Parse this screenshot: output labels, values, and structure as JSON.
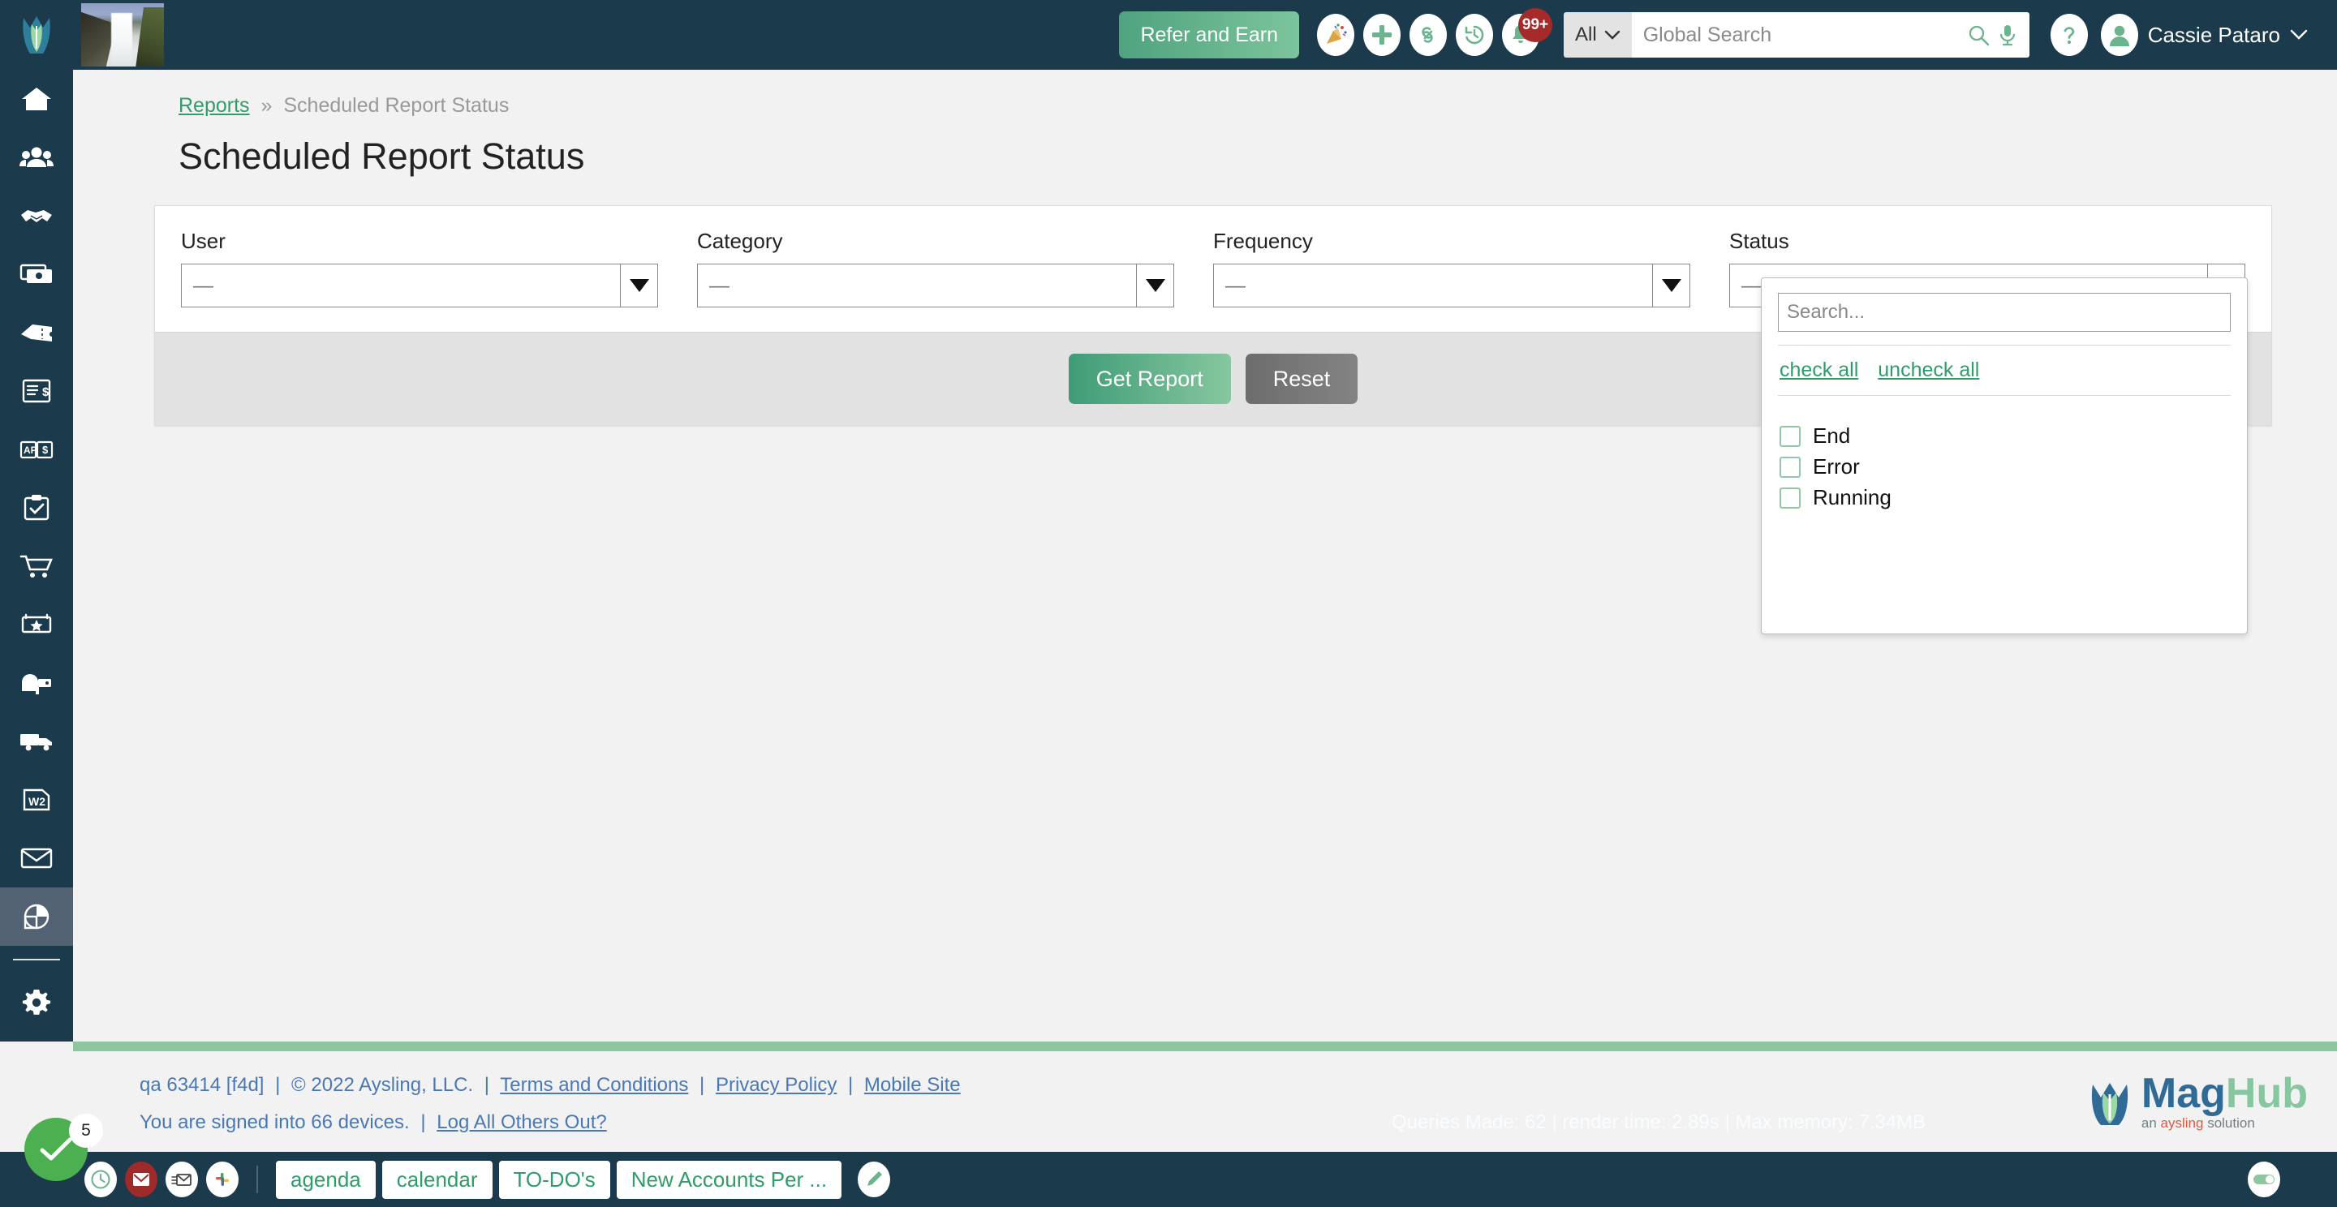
{
  "header": {
    "logo_icon": "dragon-logo",
    "thumbnail_icon": "waterfall-thumbnail",
    "refer_label": "Refer and Earn",
    "icons": [
      {
        "name": "party-popper-icon",
        "label": "party-popper"
      },
      {
        "name": "plus-icon",
        "label": "plus"
      },
      {
        "name": "link-icon",
        "label": "link"
      },
      {
        "name": "history-clock-icon",
        "label": "history"
      },
      {
        "name": "bell-icon",
        "label": "notifications"
      }
    ],
    "notification_badge": "99+",
    "search_scope": "All",
    "search_placeholder": "Global Search",
    "search_value": "",
    "help_label": "?",
    "user_name": "Cassie Pataro"
  },
  "sidebar": {
    "items": [
      {
        "name": "sidebar-item-home",
        "icon": "home-icon",
        "active": false
      },
      {
        "name": "sidebar-item-contacts",
        "icon": "people-group-icon",
        "active": false
      },
      {
        "name": "sidebar-item-deals",
        "icon": "handshake-icon",
        "active": false
      },
      {
        "name": "sidebar-item-billing",
        "icon": "money-bill-icon",
        "active": false
      },
      {
        "name": "sidebar-item-tickets",
        "icon": "ticket-icon",
        "active": false
      },
      {
        "name": "sidebar-item-invoices",
        "icon": "invoice-dollar-icon",
        "active": false
      },
      {
        "name": "sidebar-item-accounts-payable",
        "icon": "ap-book-dollar-icon",
        "active": false
      },
      {
        "name": "sidebar-item-tasks",
        "icon": "clipboard-check-icon",
        "active": false
      },
      {
        "name": "sidebar-item-orders",
        "icon": "shopping-cart-icon",
        "active": false
      },
      {
        "name": "sidebar-item-events",
        "icon": "star-box-icon",
        "active": false
      },
      {
        "name": "sidebar-item-mailbox",
        "icon": "mailbox-icon",
        "active": false
      },
      {
        "name": "sidebar-item-shipping",
        "icon": "truck-icon",
        "active": false
      },
      {
        "name": "sidebar-item-w2",
        "icon": "w2-document-icon",
        "active": false
      },
      {
        "name": "sidebar-item-email",
        "icon": "envelope-icon",
        "active": false
      },
      {
        "name": "sidebar-item-reports",
        "icon": "pie-chart-icon",
        "active": true
      },
      {
        "name": "sidebar-item-settings",
        "icon": "gear-icon",
        "active": false
      }
    ]
  },
  "breadcrumb": {
    "root_label": "Reports",
    "separator": "»",
    "current_label": "Scheduled Report Status"
  },
  "page": {
    "title": "Scheduled Report Status"
  },
  "filters": [
    {
      "name": "user",
      "label": "User",
      "value": "—"
    },
    {
      "name": "category",
      "label": "Category",
      "value": "—"
    },
    {
      "name": "frequency",
      "label": "Frequency",
      "value": "—"
    },
    {
      "name": "status",
      "label": "Status",
      "value": "—"
    }
  ],
  "actions": {
    "get_report_label": "Get Report",
    "reset_label": "Reset"
  },
  "status_panel": {
    "search_placeholder": "Search...",
    "search_value": "",
    "check_all_label": "check all",
    "uncheck_all_label": "uncheck all",
    "options": [
      {
        "label": "End",
        "checked": false
      },
      {
        "label": "Error",
        "checked": false
      },
      {
        "label": "Running",
        "checked": false
      }
    ]
  },
  "footer": {
    "build": "qa 63414 [f4d]",
    "copyright": "© 2022 Aysling, LLC.",
    "terms_label": "Terms and Conditions",
    "privacy_label": "Privacy Policy",
    "mobile_label": "Mobile Site",
    "devices_text": "You are signed into 66 devices.",
    "logout_others_label": "Log All Others Out?",
    "perf_text": "Queries Made: 62 | render time: 2.89s | Max memory: 7.34MB",
    "logo_mag": "Mag",
    "logo_hub": "Hub",
    "tag_an": "an ",
    "tag_aysling": "aysling",
    "tag_solution": " solution"
  },
  "taskbar": {
    "check_badge": "5",
    "icons": [
      {
        "name": "taskbar-clock-icon",
        "label": "clock"
      },
      {
        "name": "taskbar-mail-alert-icon",
        "label": "mail-alert"
      },
      {
        "name": "taskbar-email-icon",
        "label": "email"
      },
      {
        "name": "taskbar-slack-icon",
        "label": "slack"
      }
    ],
    "tabs": [
      {
        "label": "agenda"
      },
      {
        "label": "calendar"
      },
      {
        "label": "TO-DO's"
      },
      {
        "label": "New Accounts Per ..."
      }
    ],
    "pencil_icon": "pencil-icon",
    "toggle_icon": "toggle-on-icon"
  },
  "colors": {
    "header_bg": "#1b3a4b",
    "accent_green": "#2f9c6b",
    "light_green": "#8ec79f",
    "link_blue": "#4a78b5",
    "badge_red": "#a52a2a",
    "active_nav": "#546373"
  }
}
